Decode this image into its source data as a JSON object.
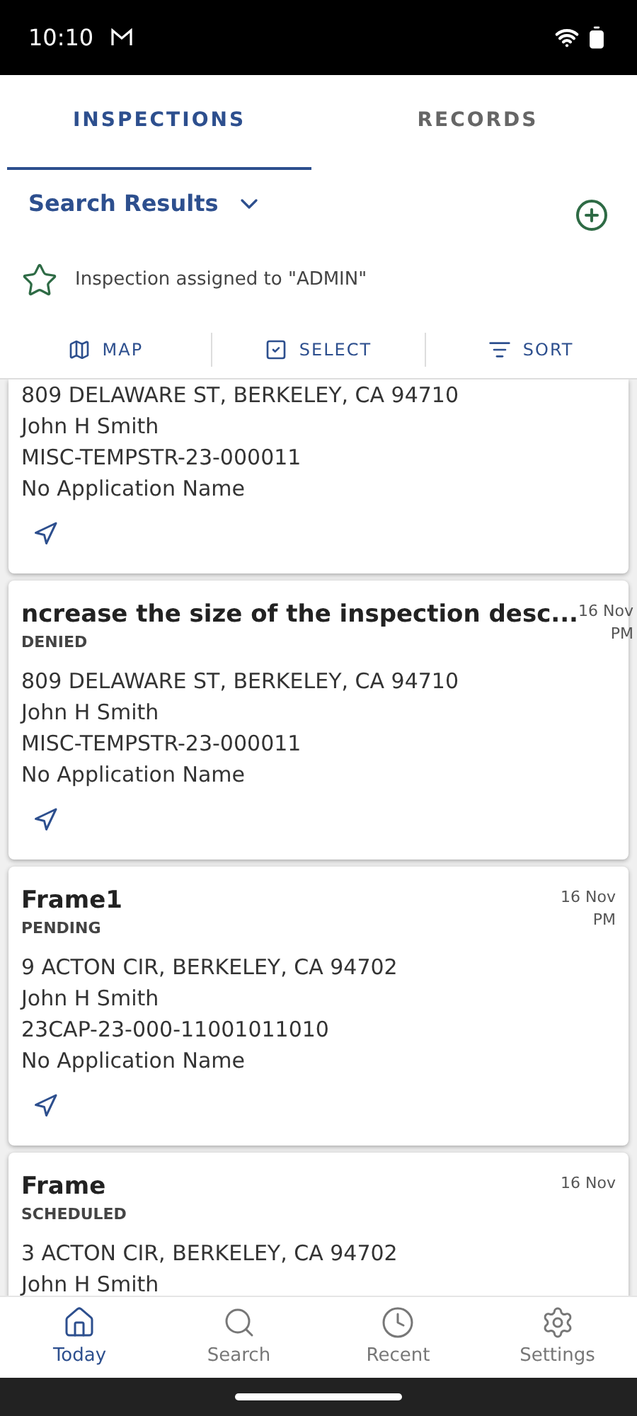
{
  "status_bar": {
    "time": "10:10"
  },
  "tabs": [
    {
      "label": "INSPECTIONS",
      "selected": true
    },
    {
      "label": "RECORDS",
      "selected": false
    }
  ],
  "filter": {
    "label": "Search Results"
  },
  "assigned_note": "Inspection assigned to \"ADMIN\"",
  "toolbar": [
    {
      "kind": "map",
      "label": "MAP"
    },
    {
      "kind": "select",
      "label": "SELECT"
    },
    {
      "kind": "sort",
      "label": "SORT"
    }
  ],
  "cards": [
    {
      "lines": [
        "809 DELAWARE ST, BERKELEY, CA 94710",
        "John H Smith",
        "MISC-TEMPSTR-23-000011",
        "No Application Name"
      ],
      "navigate": true
    },
    {
      "title": "ncrease the size of the inspection desc...",
      "status": "DENIED",
      "date": "16 Nov",
      "time": "PM",
      "lines": [
        "809 DELAWARE ST, BERKELEY, CA 94710",
        "John H Smith",
        "MISC-TEMPSTR-23-000011",
        "No Application Name"
      ],
      "navigate": true
    },
    {
      "title": "Frame1",
      "status": "PENDING",
      "date": "16 Nov",
      "time": "PM",
      "lines": [
        "9 ACTON CIR, BERKELEY, CA 94702",
        "John H Smith",
        "23CAP-23-000-11001011010",
        "No Application Name"
      ],
      "navigate": true
    },
    {
      "title": "Frame",
      "status": "SCHEDULED",
      "date": "16 Nov",
      "lines": [
        "3 ACTON CIR, BERKELEY, CA 94702",
        "John H Smith"
      ],
      "navigate": false
    }
  ],
  "bottom_nav": [
    {
      "kind": "home",
      "label": "Today",
      "selected": true
    },
    {
      "kind": "search",
      "label": "Search",
      "selected": false
    },
    {
      "kind": "recent",
      "label": "Recent",
      "selected": false
    },
    {
      "kind": "settings",
      "label": "Settings",
      "selected": false
    }
  ]
}
